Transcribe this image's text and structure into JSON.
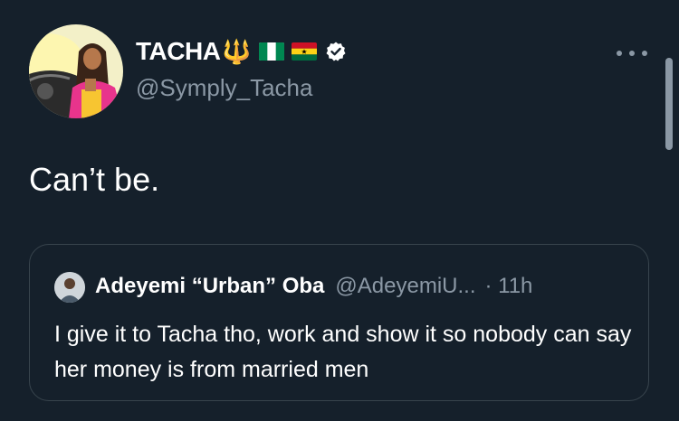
{
  "tweet": {
    "author": {
      "display_name": "TACHA",
      "name_emoji": "🔱",
      "flags": [
        "nigeria-flag",
        "ghana-flag"
      ],
      "verified": true,
      "handle": "@Symply_Tacha"
    },
    "text": "Can’t be.",
    "more_icon": "more-icon"
  },
  "quote": {
    "author": {
      "display_name": "Adeyemi “Urban” Oba",
      "handle": "@AdeyemiU...",
      "time": "· 11h"
    },
    "text": "I give it to Tacha tho, work and show it so nobody can say her money is from married men"
  },
  "colors": {
    "background": "#15202b",
    "text": "#e7e9ea",
    "secondary": "#8b98a5",
    "border": "#38444d",
    "verified": "#ffffff"
  }
}
